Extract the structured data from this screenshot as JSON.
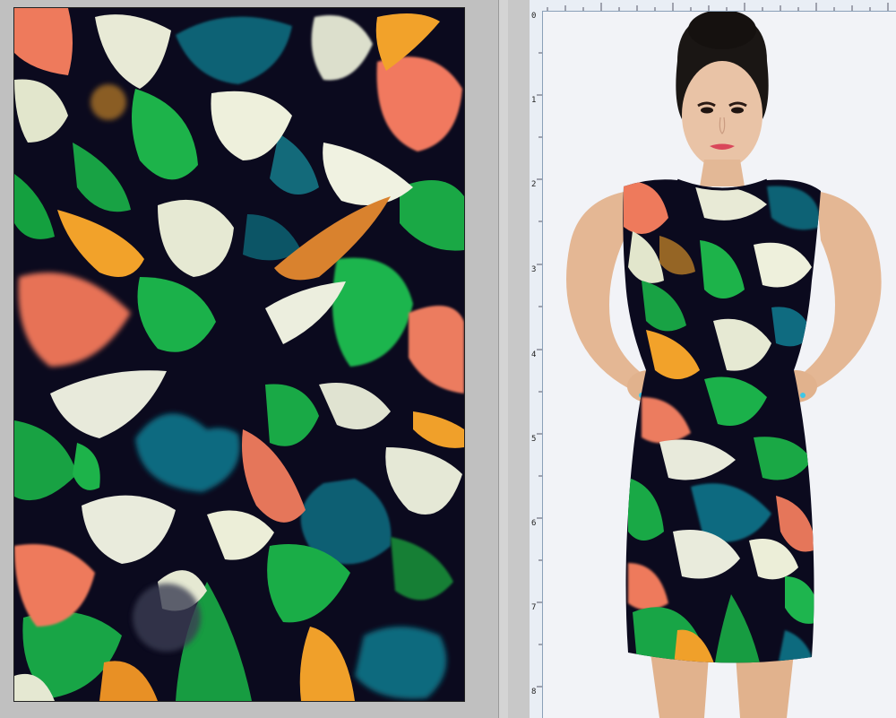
{
  "workspace": {
    "left_pane": {
      "name": "pattern-canvas"
    },
    "right_pane": {
      "name": "mockup-document"
    }
  },
  "ruler": {
    "vertical_marks": [
      "0",
      "1",
      "2",
      "3",
      "4",
      "5",
      "6",
      "7",
      "8"
    ]
  },
  "colors": {
    "canvas_bg": "#0b0a1e",
    "accent_green": "#1db34a",
    "accent_teal": "#0d5f72",
    "accent_cream": "#e8ead6",
    "accent_salmon": "#ee7a5c",
    "accent_orange": "#f2a22a",
    "ruler_bg": "#e9eef5",
    "window_bg": "#c3c3c3"
  }
}
